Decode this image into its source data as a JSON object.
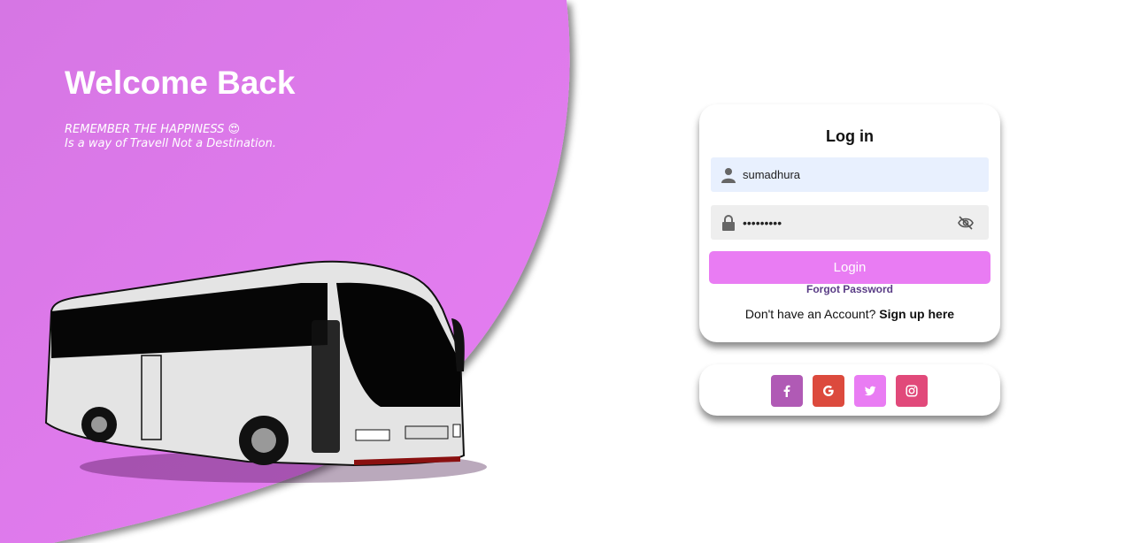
{
  "hero": {
    "title": "Welcome Back",
    "tagline_line1": "REMEMBER THE HAPPINESS 😍",
    "tagline_line2": "Is a way of Travell Not a Destination.",
    "background_color": "#e07ae8"
  },
  "login": {
    "title": "Log in",
    "username_value": "sumadhura",
    "password_value": "•••••••••",
    "login_button": "Login",
    "forgot_password": "Forgot Password",
    "signup_prompt": "Don't have an Account?",
    "signup_link": "Sign up here",
    "accent_color": "#e97cf3"
  },
  "social": {
    "buttons": [
      {
        "name": "facebook",
        "icon": "facebook-icon",
        "color": "#b05ab5"
      },
      {
        "name": "google",
        "icon": "google-icon",
        "color": "#dc4a3d"
      },
      {
        "name": "twitter",
        "icon": "twitter-icon",
        "color": "#e97cf3"
      },
      {
        "name": "instagram",
        "icon": "instagram-icon",
        "color": "#e1497a"
      }
    ]
  }
}
